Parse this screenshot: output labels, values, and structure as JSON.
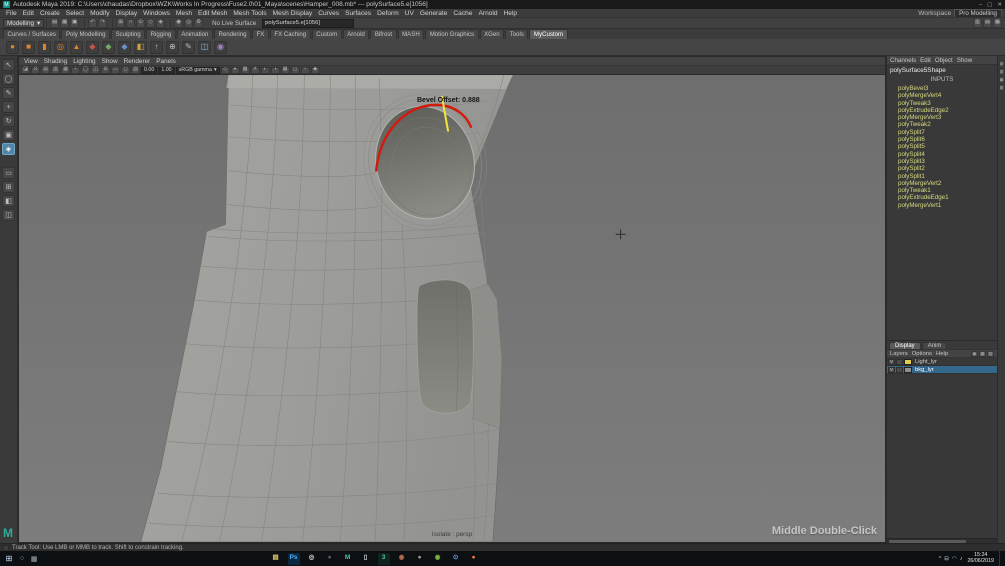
{
  "window": {
    "title": "Autodesk Maya 2019: C:\\Users\\chaudas\\Dropbox\\WZK\\Works In Progress\\Fuse2.0\\01_Maya\\scenes\\Hamper_008.mb* --- polySurface5.e[1056]",
    "app_icon_glyph": "M",
    "controls": [
      {
        "name": "minimize-button",
        "glyph": "–"
      },
      {
        "name": "maximize-button",
        "glyph": "▢"
      },
      {
        "name": "close-button",
        "glyph": "✕"
      }
    ]
  },
  "menu_bar": {
    "items": [
      "File",
      "Edit",
      "Create",
      "Select",
      "Modify",
      "Display",
      "Windows",
      "Mesh",
      "Edit Mesh",
      "Mesh Tools",
      "Mesh Display",
      "Curves",
      "Surfaces",
      "Deform",
      "UV",
      "Generate",
      "Cache",
      "Arnold",
      "Help"
    ],
    "workspace_label": "Workspace",
    "workspace_value": "Pro Modelling"
  },
  "status_line": {
    "menu_set": "Modelling",
    "dropdown_arrow": "▾",
    "file_icons": [
      {
        "name": "new-scene-icon",
        "glyph": "▤"
      },
      {
        "name": "open-scene-icon",
        "glyph": "▦"
      },
      {
        "name": "save-scene-icon",
        "glyph": "▣"
      }
    ],
    "edit_icons": [
      {
        "name": "undo-icon",
        "glyph": "↶"
      },
      {
        "name": "redo-icon",
        "glyph": "↷"
      }
    ],
    "snap_icons": [
      {
        "name": "snap-to-grid-icon",
        "glyph": "⊞"
      },
      {
        "name": "snap-to-curve-icon",
        "glyph": "∩"
      },
      {
        "name": "snap-to-point-icon",
        "glyph": "⊙"
      },
      {
        "name": "snap-to-plane-icon",
        "glyph": "◇"
      },
      {
        "name": "make-live-icon",
        "glyph": "◈"
      }
    ],
    "render_icons": [
      {
        "name": "render-current-frame-icon",
        "glyph": "◉"
      },
      {
        "name": "ipr-render-icon",
        "glyph": "◎"
      },
      {
        "name": "render-settings-icon",
        "glyph": "⚙"
      }
    ],
    "live_surface": "No Live Surface",
    "selection_field": "polySurface5.e[1056]",
    "panel_toggle_icons": [
      {
        "name": "modeling-toolkit-toggle-icon",
        "glyph": "▥"
      },
      {
        "name": "attribute-editor-toggle-icon",
        "glyph": "▤"
      },
      {
        "name": "channel-box-toggle-icon",
        "glyph": "▦"
      }
    ]
  },
  "shelf": {
    "tabs": [
      {
        "label": "Curves / Surfaces"
      },
      {
        "label": "Poly Modelling"
      },
      {
        "label": "Sculpting"
      },
      {
        "label": "Rigging"
      },
      {
        "label": "Animation"
      },
      {
        "label": "Rendering"
      },
      {
        "label": "FX"
      },
      {
        "label": "FX Caching"
      },
      {
        "label": "Custom"
      },
      {
        "label": "Arnold"
      },
      {
        "label": "Bifrost"
      },
      {
        "label": "MASH"
      },
      {
        "label": "Motion Graphics"
      },
      {
        "label": "XGen"
      },
      {
        "label": "Tools"
      },
      {
        "label": "MyCustom",
        "state": "active"
      }
    ],
    "icons": [
      {
        "name": "shelf-sphere-icon",
        "glyph": "●",
        "fg": "#e0862c"
      },
      {
        "name": "shelf-cube-icon",
        "glyph": "■",
        "fg": "#e0862c"
      },
      {
        "name": "shelf-cylinder-icon",
        "glyph": "▮",
        "fg": "#e0862c"
      },
      {
        "name": "shelf-torus-icon",
        "glyph": "◎",
        "fg": "#e0862c"
      },
      {
        "name": "shelf-cone-icon",
        "glyph": "▲",
        "fg": "#e0862c"
      },
      {
        "name": "shelf-red-tool-icon",
        "glyph": "◆",
        "fg": "#c75450"
      },
      {
        "name": "shelf-green-tool-icon",
        "glyph": "◆",
        "fg": "#79a765"
      },
      {
        "name": "shelf-blue-tool-icon",
        "glyph": "◆",
        "fg": "#6b95c8"
      },
      {
        "name": "shelf-bevel-icon",
        "glyph": "◧",
        "fg": "#cfa23a"
      },
      {
        "name": "shelf-extrude-icon",
        "glyph": "↑",
        "fg": "#bdbdbd"
      },
      {
        "name": "shelf-merge-icon",
        "glyph": "⊕",
        "fg": "#bdbdbd"
      },
      {
        "name": "shelf-multicut-icon",
        "glyph": "✎",
        "fg": "#bdbdbd"
      },
      {
        "name": "shelf-mirror-icon",
        "glyph": "◫",
        "fg": "#8fb4d6"
      },
      {
        "name": "shelf-smooth-icon",
        "glyph": "◉",
        "fg": "#a488c9"
      }
    ]
  },
  "toolbox": {
    "tools": [
      {
        "name": "select-tool-icon",
        "glyph": "↖"
      },
      {
        "name": "lasso-select-tool-icon",
        "glyph": "◯"
      },
      {
        "name": "paint-select-tool-icon",
        "glyph": "✎"
      },
      {
        "name": "move-tool-icon",
        "glyph": "+"
      },
      {
        "name": "rotate-tool-icon",
        "glyph": "↻"
      },
      {
        "name": "scale-tool-icon",
        "glyph": "▣"
      },
      {
        "name": "current-tool-icon",
        "glyph": "◈",
        "state": "active"
      }
    ],
    "layouts": [
      {
        "name": "single-pane-layout-icon",
        "glyph": "▭"
      },
      {
        "name": "four-pane-layout-icon",
        "glyph": "⊞"
      },
      {
        "name": "persp-outliner-layout-icon",
        "glyph": "◧"
      },
      {
        "name": "two-pane-layout-icon",
        "glyph": "◫"
      }
    ]
  },
  "viewport": {
    "menus": [
      "View",
      "Shading",
      "Lighting",
      "Show",
      "Renderer",
      "Panels"
    ],
    "toolbar": {
      "left_icons": [
        {
          "name": "vp-select-camera-icon",
          "glyph": "◪"
        },
        {
          "name": "vp-lock-camera-icon",
          "glyph": "⊙"
        },
        {
          "name": "vp-camera-attributes-icon",
          "glyph": "▤"
        },
        {
          "name": "vp-bookmarks-icon",
          "glyph": "▥"
        },
        {
          "name": "vp-image-plane-icon",
          "glyph": "▦"
        },
        {
          "name": "vp-2d-pan-zoom-icon",
          "glyph": "+"
        },
        {
          "name": "vp-oversample-icon",
          "glyph": "◯"
        },
        {
          "name": "vp-isolate-select-icon",
          "glyph": "◫"
        },
        {
          "name": "vp-grid-toggle-icon",
          "glyph": "⊞"
        },
        {
          "name": "vp-film-gate-icon",
          "glyph": "▭"
        },
        {
          "name": "vp-resolution-gate-icon",
          "glyph": "◻"
        },
        {
          "name": "vp-gate-mask-icon",
          "glyph": "▨"
        }
      ],
      "exposure": "0.00",
      "gamma": "1.00",
      "view_transform": "sRGB gamma",
      "dropdown_arrow": "▾",
      "right_icons": [
        {
          "name": "vp-wireframe-icon",
          "glyph": "◇"
        },
        {
          "name": "vp-shaded-icon",
          "glyph": "●"
        },
        {
          "name": "vp-textured-icon",
          "glyph": "▩"
        },
        {
          "name": "vp-lights-icon",
          "glyph": "☀"
        },
        {
          "name": "vp-shadows-icon",
          "glyph": "◐"
        },
        {
          "name": "vp-ao-icon",
          "glyph": "◑"
        },
        {
          "name": "vp-antialias-icon",
          "glyph": "▦"
        },
        {
          "name": "vp-xray-icon",
          "glyph": "◻"
        },
        {
          "name": "vp-joint-xray-icon",
          "glyph": "+"
        },
        {
          "name": "vp-plugin-filter-icon",
          "glyph": "◆"
        }
      ]
    },
    "hud": {
      "bevel_offset_label": "Bevel Offset: 0.888",
      "camera_label": "Isolate : persp",
      "mouse_hint": "Middle Double-Click"
    }
  },
  "channel_box": {
    "menus": [
      "Channels",
      "Edit",
      "Object",
      "Show"
    ],
    "shape_name": "polySurface5Shape",
    "inputs_label": "INPUTS",
    "inputs": [
      "polyBevel3",
      "polyMergeVert4",
      "polyTweak3",
      "polyExtrudeEdge2",
      "polyMergeVert3",
      "polyTweak2",
      "polySplit7",
      "polySplit6",
      "polySplit5",
      "polySplit4",
      "polySplit3",
      "polySplit2",
      "polySplit1",
      "polyMergeVert2",
      "polyTweak1",
      "polyExtrudeEdge1",
      "polyMergeVert1"
    ]
  },
  "layer_editor": {
    "tabs": [
      {
        "label": "Display",
        "state": "active"
      },
      {
        "label": "Anim"
      }
    ],
    "menus": [
      "Layers",
      "Options",
      "Help"
    ],
    "buttons": [
      {
        "name": "layers-visibility-icon",
        "glyph": "◉"
      },
      {
        "name": "new-empty-layer-icon",
        "glyph": "▦"
      },
      {
        "name": "new-layer-from-selected-icon",
        "glyph": "▧"
      }
    ],
    "layers": [
      {
        "name": "Light_lyr",
        "v": "V",
        "swatch": "#e3cd4e",
        "state": ""
      },
      {
        "name": "bkg_lyr",
        "v": "V",
        "swatch": "#8f8f8f",
        "state": "selected"
      }
    ]
  },
  "right_strip": {
    "icons": [
      {
        "name": "channel-box-strip-icon",
        "glyph": "▤"
      },
      {
        "name": "attribute-editor-strip-icon",
        "glyph": "▥"
      },
      {
        "name": "tool-settings-strip-icon",
        "glyph": "▦"
      },
      {
        "name": "outliner-strip-icon",
        "glyph": "▧"
      }
    ]
  },
  "help_line": {
    "text": "Track Tool: Use LMB or MMB to track. Shift to constrain tracking."
  },
  "taskbar": {
    "start_glyph": "⊞",
    "left_icons": [
      {
        "name": "search-icon",
        "glyph": "○"
      },
      {
        "name": "task-view-icon",
        "glyph": "▦"
      }
    ],
    "apps": [
      {
        "name": "file-explorer-icon",
        "glyph": "▤",
        "fg": "#e3c56b",
        "bg": ""
      },
      {
        "name": "photoshop-icon",
        "glyph": "Ps",
        "fg": "#4db2ff",
        "bg": "#0b2840"
      },
      {
        "name": "camera-raw-icon",
        "glyph": "◎",
        "fg": "#d8d8d8",
        "bg": ""
      },
      {
        "name": "dark-app-icon",
        "glyph": "●",
        "fg": "#5a5f66",
        "bg": ""
      },
      {
        "name": "maya-icon",
        "glyph": "M",
        "fg": "#49c5b1",
        "bg": ""
      },
      {
        "name": "notes-app-icon",
        "glyph": "▯",
        "fg": "#cfd8dc",
        "bg": ""
      },
      {
        "name": "3dsmax-icon",
        "glyph": "3",
        "fg": "#52c7a0",
        "bg": "#10231e"
      },
      {
        "name": "substance-icon",
        "glyph": "◉",
        "fg": "#b56c4e",
        "bg": ""
      },
      {
        "name": "media-app-icon",
        "glyph": "●",
        "fg": "#9e9e9e",
        "bg": ""
      },
      {
        "name": "chrome-icon",
        "glyph": "◉",
        "fg": "#7cb342",
        "bg": ""
      },
      {
        "name": "skype-icon",
        "glyph": "⊙",
        "fg": "#64a0ff",
        "bg": ""
      },
      {
        "name": "firefox-icon",
        "glyph": "●",
        "fg": "#ff7a33",
        "bg": ""
      }
    ],
    "tray_icons": [
      {
        "name": "hidden-icons-chevron-icon",
        "glyph": "^"
      },
      {
        "name": "display-tray-icon",
        "glyph": "⊟"
      },
      {
        "name": "network-icon",
        "glyph": "◠"
      },
      {
        "name": "volume-icon",
        "glyph": "♪"
      }
    ],
    "time": "15:24",
    "date": "26/06/2019"
  }
}
